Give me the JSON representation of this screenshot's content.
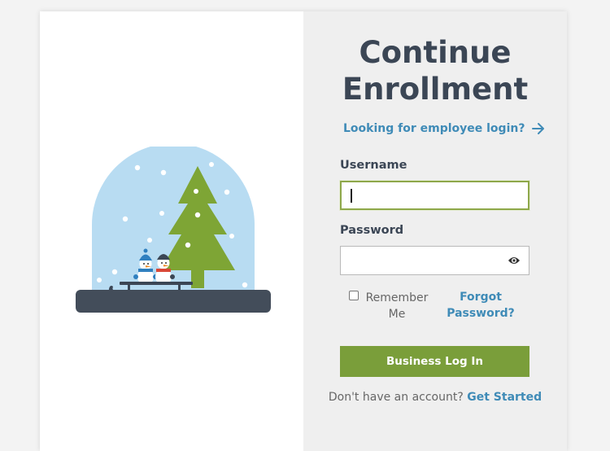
{
  "form": {
    "title_line1": "Continue",
    "title_line2": "Enrollment",
    "employee_login_link": "Looking for employee login?",
    "username_label": "Username",
    "username_value": "",
    "password_label": "Password",
    "password_value": "",
    "remember_line1": "Remember",
    "remember_line2": "Me",
    "remember_checked": false,
    "forgot_line1": "Forgot",
    "forgot_line2": "Password?",
    "login_button": "Business Log In",
    "no_account_text": "Don't have an account?",
    "get_started_link": "Get Started"
  },
  "icons": {
    "arrow": "arrow-right-icon",
    "eye": "eye-icon",
    "illustration": "snow-globe-illustration"
  },
  "colors": {
    "title": "#3b4655",
    "link": "#3f8bb7",
    "button": "#7a9e3a",
    "right_panel_bg": "#efefef",
    "globe_sky": "#b8dcf2",
    "tree": "#7ea535",
    "base": "#434d5a"
  }
}
